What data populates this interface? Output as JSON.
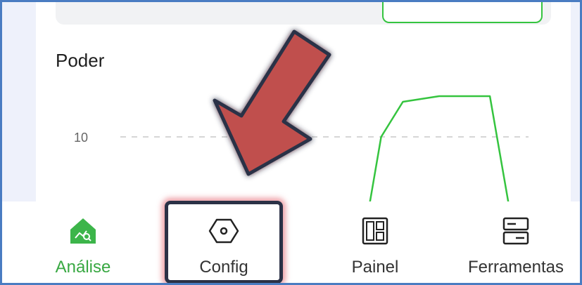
{
  "chart": {
    "title": "Poder",
    "y_tick": "10"
  },
  "chart_data": {
    "type": "line",
    "title": "Poder",
    "y_ticks": [
      10
    ],
    "series": [
      {
        "color": "#35c43f",
        "points": [
          [
            0.0,
            4
          ],
          [
            0.1,
            10
          ],
          [
            0.25,
            12.5
          ],
          [
            0.5,
            12.9
          ],
          [
            0.85,
            12.9
          ],
          [
            1.0,
            4
          ]
        ]
      }
    ]
  },
  "nav": {
    "items": [
      {
        "label": "Análise",
        "icon": "analytics-icon",
        "active": true
      },
      {
        "label": "Config",
        "icon": "hexagon-nut-icon",
        "active": false
      },
      {
        "label": "Painel",
        "icon": "dashboard-icon",
        "active": false
      },
      {
        "label": "Ferramentas",
        "icon": "tools-icon",
        "active": false
      }
    ]
  },
  "colors": {
    "accent": "#38a842",
    "line": "#35c43f",
    "annotation_arrow": "#c0504d",
    "annotation_box": "#2b3146",
    "frame_border": "#4a7cc2"
  }
}
